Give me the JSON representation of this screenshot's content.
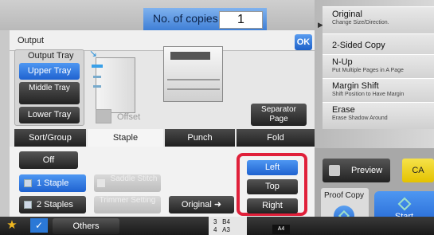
{
  "header": {
    "copies_label": "No. of copies",
    "copies_value": "1"
  },
  "right_panel": {
    "items": [
      {
        "title": "Original",
        "subtitle": "Change Size/Direction."
      },
      {
        "title": "2-Sided Copy",
        "subtitle": ""
      },
      {
        "title": "N-Up",
        "subtitle": "Put Multiple Pages in A Page"
      },
      {
        "title": "Margin Shift",
        "subtitle": "Shift Position to Have Margin"
      },
      {
        "title": "Erase",
        "subtitle": "Erase Shadow Around"
      }
    ],
    "preview_label": "Preview",
    "ca_label": "CA",
    "proof_label": "Proof Copy",
    "start_label": "Start"
  },
  "output": {
    "title": "Output",
    "ok_label": "OK",
    "tray_label": "Output Tray",
    "trays": [
      "Upper Tray",
      "Middle Tray",
      "Lower Tray"
    ],
    "offset_label": "Offset",
    "separator_label": "Separator Page"
  },
  "tabs": [
    "Sort/Group",
    "Staple",
    "Punch",
    "Fold"
  ],
  "staple": {
    "options": [
      "Off",
      "1 Staple",
      "2 Staples"
    ],
    "saddle_label": "Saddle Stitch",
    "trimmer_label": "Trimmer Setting",
    "original_label": "Original",
    "positions": [
      "Left",
      "Top",
      "Right"
    ]
  },
  "bottom": {
    "others_label": "Others",
    "size_nums": [
      "3",
      "4"
    ],
    "size_vals": [
      "B4",
      "A3"
    ],
    "badge": "A4"
  },
  "colors": {
    "accent": "#1f62d0",
    "highlight": "#e0203a",
    "copies_bg": "#5a93e2"
  }
}
